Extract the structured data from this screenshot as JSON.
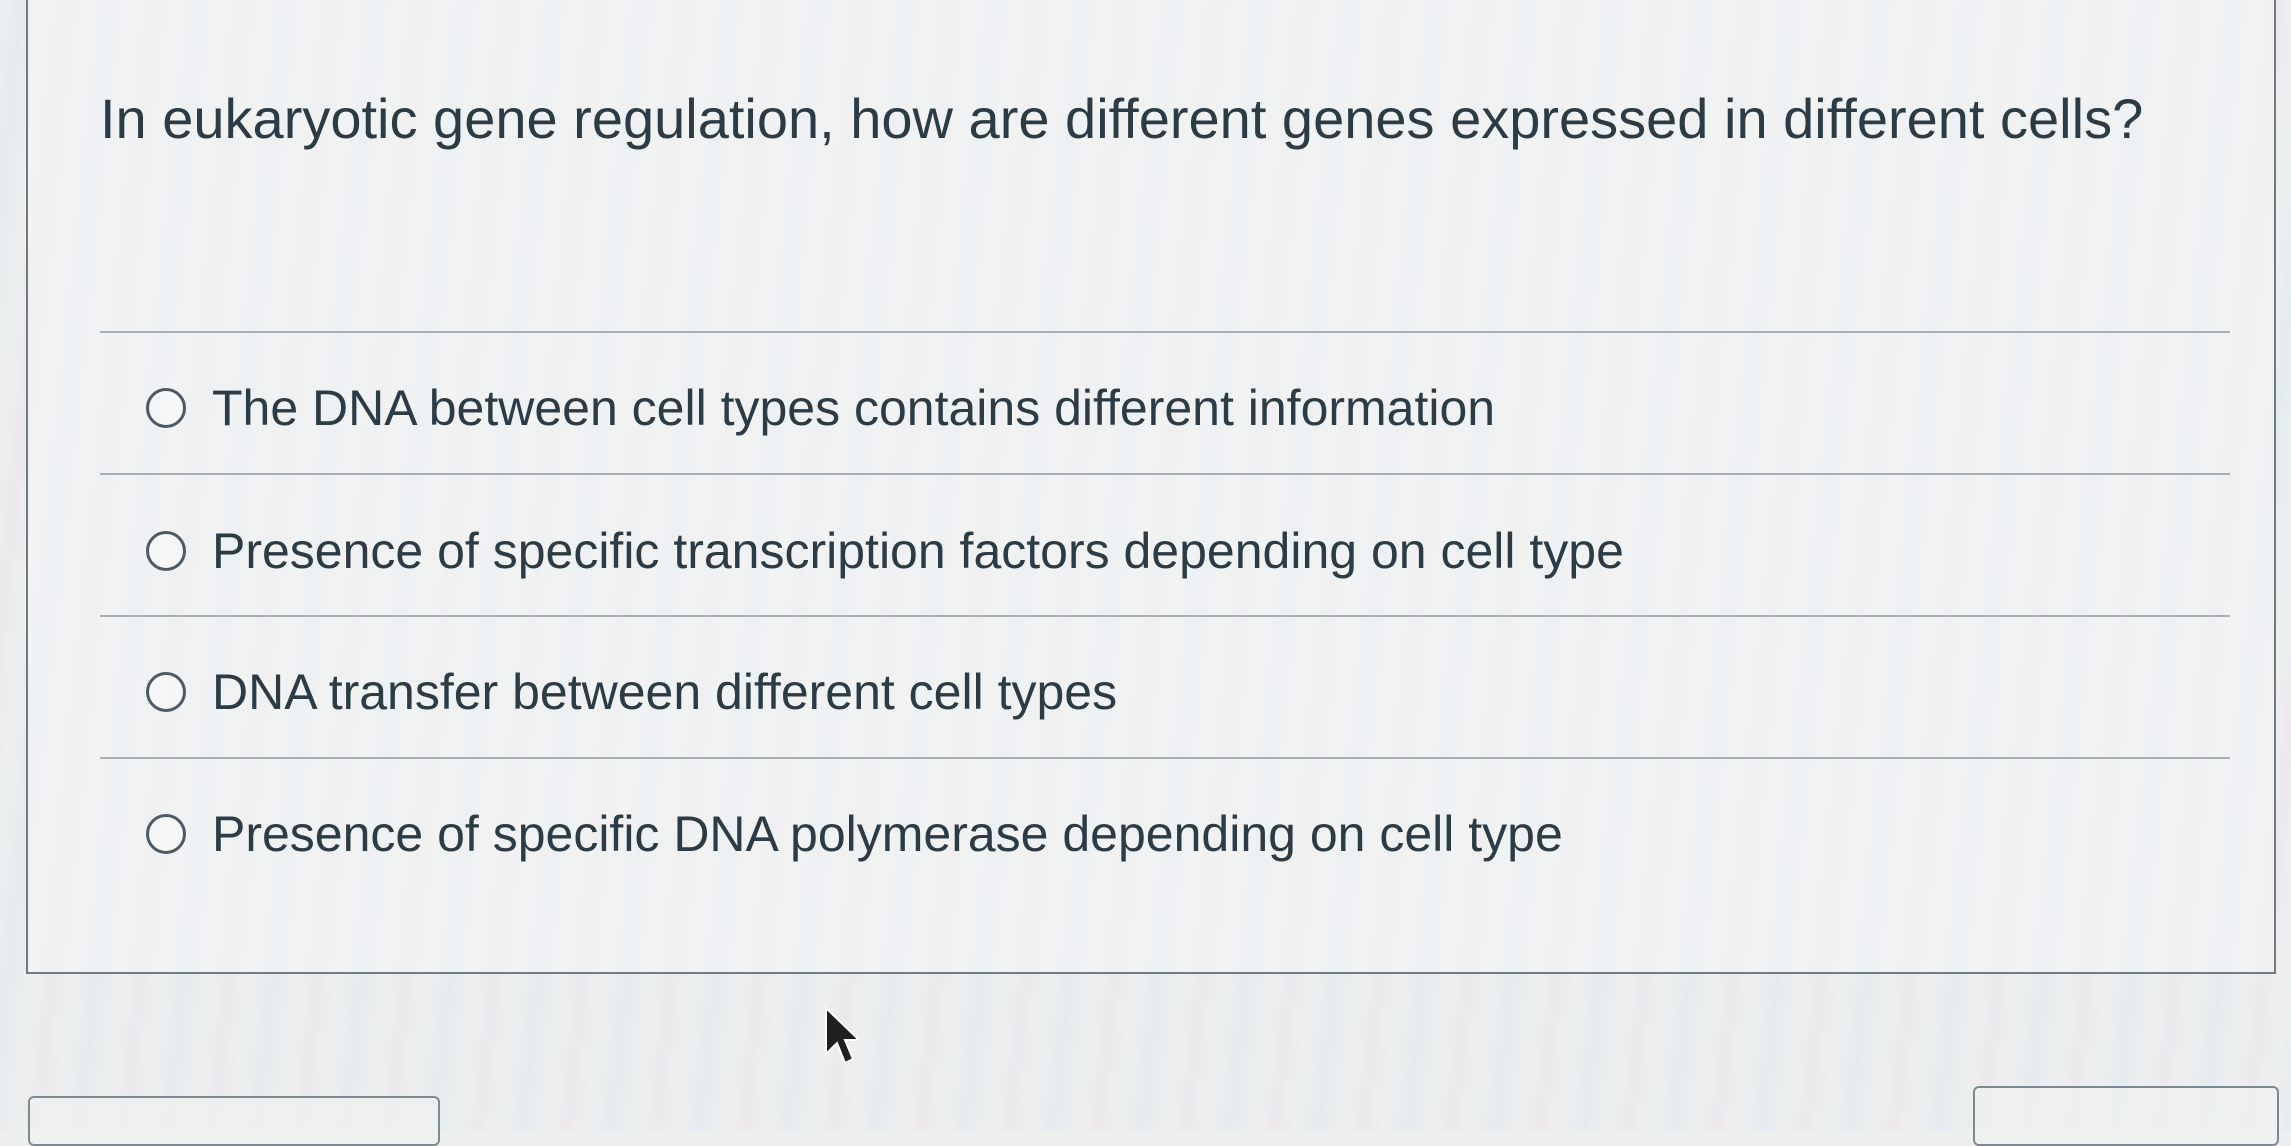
{
  "question": {
    "text": "In eukaryotic gene regulation, how are different genes expressed in different cells?"
  },
  "answers": [
    {
      "label": "The DNA between cell types contains different information"
    },
    {
      "label": "Presence of specific transcription factors depending on cell type"
    },
    {
      "label": "DNA transfer between different cell types"
    },
    {
      "label": "Presence of specific DNA polymerase depending on cell type"
    }
  ],
  "icons": {
    "radio": "radio-button-unselected-icon",
    "cursor": "mouse-pointer-icon"
  },
  "colors": {
    "text": "#2d3b45",
    "border": "#6f7a82",
    "divider": "#a7b0b7"
  }
}
